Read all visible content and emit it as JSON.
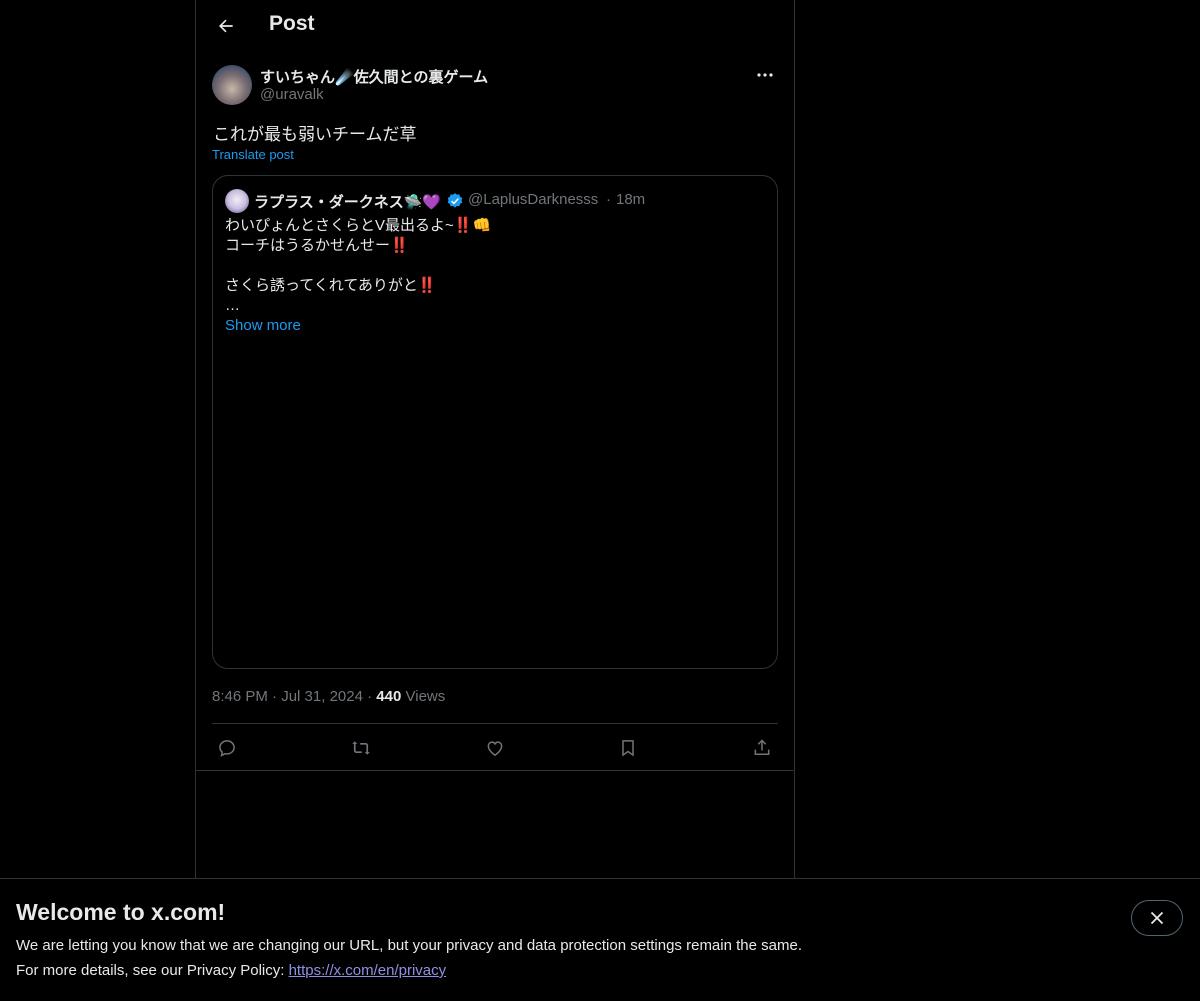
{
  "header": {
    "title": "Post",
    "back_icon": "arrow-left-icon"
  },
  "post": {
    "author": {
      "display_name": "すいちゃん☄️佐久間との裏ゲーム",
      "handle": "@uravalk"
    },
    "text": "これが最も弱いチームだ草",
    "translate_label": "Translate post",
    "quote": {
      "author_name": "ラプラス・ダークネス🛸💜",
      "handle": "@LaplusDarknesss",
      "separator": "·",
      "time": "18m",
      "lines": [
        "わいぴょんとさくらとV最出るよ~‼️👊",
        "コーチはうるかせんせー‼️",
        "",
        "さくら誘ってくれてありがと‼️",
        "…"
      ],
      "show_more_label": "Show more"
    },
    "meta": {
      "time": "8:46 PM",
      "dot": "·",
      "date": "Jul 31, 2024",
      "views_count": "440",
      "views_label": "Views"
    },
    "actions": [
      "reply-icon",
      "repost-icon",
      "like-icon",
      "bookmark-icon",
      "share-icon"
    ]
  },
  "banner": {
    "title": "Welcome to x.com!",
    "line1": "We are letting you know that we are changing our URL, but your privacy and data protection settings remain the same.",
    "line2_prefix": "For more details, see our Privacy Policy: ",
    "link": "https://x.com/en/privacy"
  },
  "colors": {
    "background": "#000000",
    "text": "#e7e9ea",
    "muted": "#71767b",
    "accent": "#1d9bf0",
    "border": "#2f3336"
  }
}
